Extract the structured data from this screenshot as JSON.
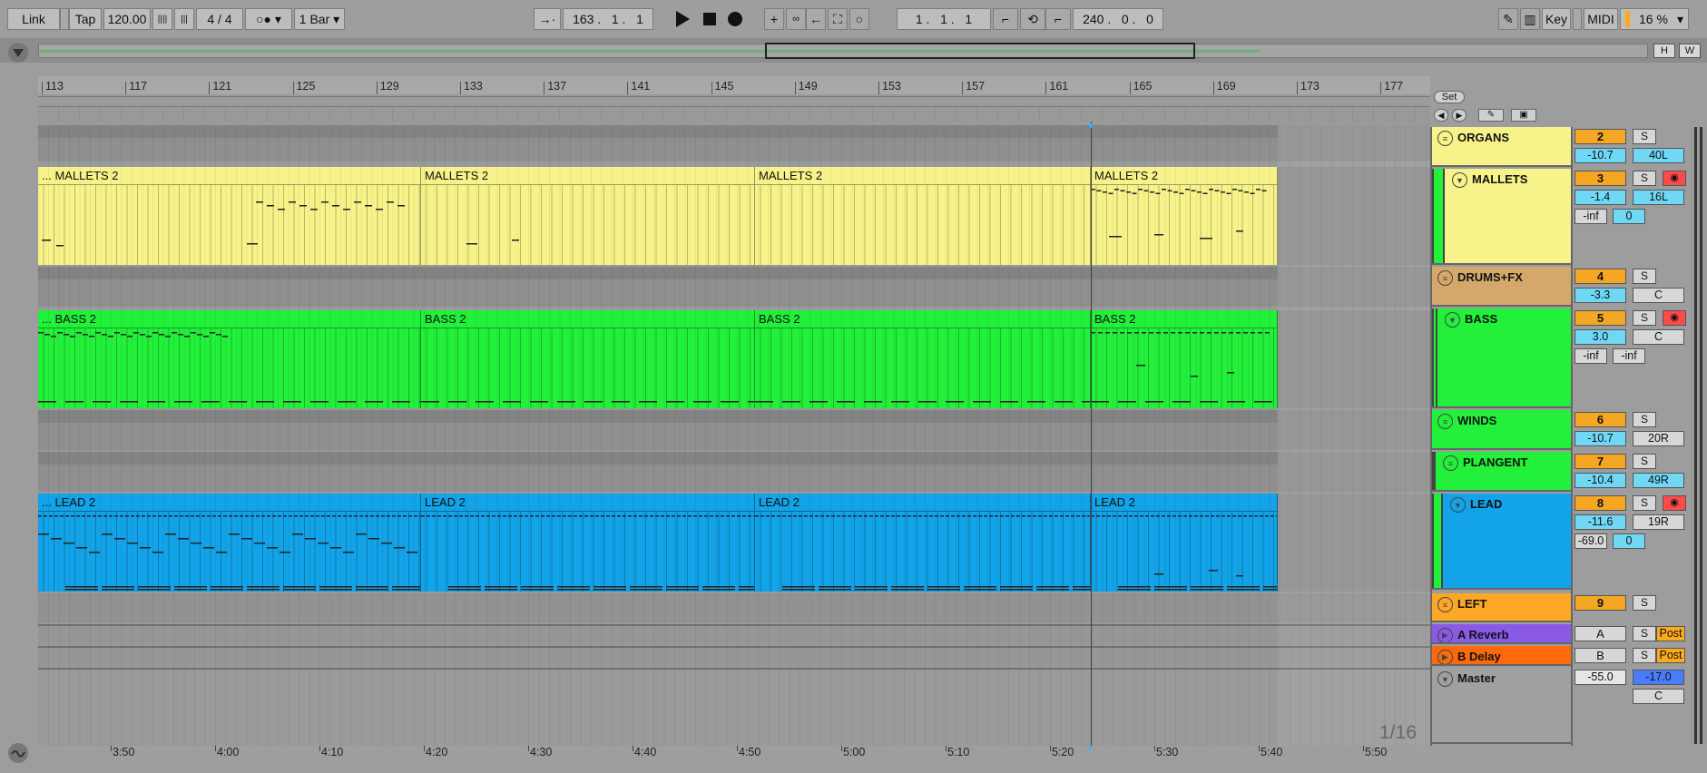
{
  "colors": {
    "mallets": "#f7f38a",
    "bass": "#22f03a",
    "lead": "#12a3e8",
    "drums": "#d4a86a",
    "left": "#ffa727",
    "reverb": "#8a5ae6",
    "delay": "#ff6a0c"
  },
  "control_bar": {
    "link": "Link",
    "tap": "Tap",
    "tempo": "120.00",
    "signature": "4 / 4",
    "metro_icon": "metronome-icon",
    "quantize": "1 Bar",
    "position": "163 .   1 .   1",
    "loop_start": "1 .   1 .   1",
    "loop_length": "240 .   0 .   0",
    "key": "Key",
    "midi": "MIDI",
    "zoom": "16 %"
  },
  "overview": {
    "h": "H",
    "w": "W"
  },
  "ruler": {
    "bars": [
      "113",
      "117",
      "121",
      "125",
      "129",
      "133",
      "137",
      "141",
      "145",
      "149",
      "153",
      "157",
      "161",
      "165",
      "169",
      "173",
      "177"
    ]
  },
  "timeline": {
    "times": [
      "3:50",
      "4:00",
      "4:10",
      "4:20",
      "4:30",
      "4:40",
      "4:50",
      "5:00",
      "5:10",
      "5:20",
      "5:30",
      "5:40",
      "5:50"
    ]
  },
  "clips": {
    "mallets": [
      "... MALLETS 2",
      "MALLETS 2",
      "MALLETS 2",
      "MALLETS 2"
    ],
    "bass": [
      "... BASS 2",
      "BASS 2",
      "BASS 2",
      "BASS 2"
    ],
    "lead": [
      "... LEAD 2",
      "LEAD 2",
      "LEAD 2",
      "LEAD 2"
    ]
  },
  "set_button": "Set",
  "grid_label": "1/16",
  "tracks": [
    {
      "name": "ORGANS",
      "num": "2",
      "s": "S",
      "vol": "-10.7",
      "pan": "40L"
    },
    {
      "name": "MALLETS",
      "num": "3",
      "s": "S",
      "vol": "-1.4",
      "pan": "16L",
      "sendA": "-inf",
      "sendB": "0"
    },
    {
      "name": "DRUMS+FX",
      "num": "4",
      "s": "S",
      "vol": "-3.3",
      "pan": "C"
    },
    {
      "name": "BASS",
      "num": "5",
      "s": "S",
      "vol": "3.0",
      "pan": "C",
      "sendA": "-inf",
      "sendB": "-inf"
    },
    {
      "name": "WINDS",
      "num": "6",
      "s": "S",
      "vol": "-10.7",
      "pan": "20R"
    },
    {
      "name": "PLANGENT",
      "num": "7",
      "s": "S",
      "vol": "-10.4",
      "pan": "49R"
    },
    {
      "name": "LEAD",
      "num": "8",
      "s": "S",
      "vol": "-11.6",
      "pan": "19R",
      "sendA": "-69.0",
      "sendB": "0"
    },
    {
      "name": "LEFT",
      "num": "9",
      "s": "S"
    },
    {
      "name": "A Reverb",
      "num": "A",
      "s": "S",
      "post": "Post"
    },
    {
      "name": "B Delay",
      "num": "B",
      "s": "S",
      "post": "Post"
    },
    {
      "name": "Master",
      "vol": "-55.0",
      "vol2": "-17.0",
      "pan": "C"
    }
  ]
}
